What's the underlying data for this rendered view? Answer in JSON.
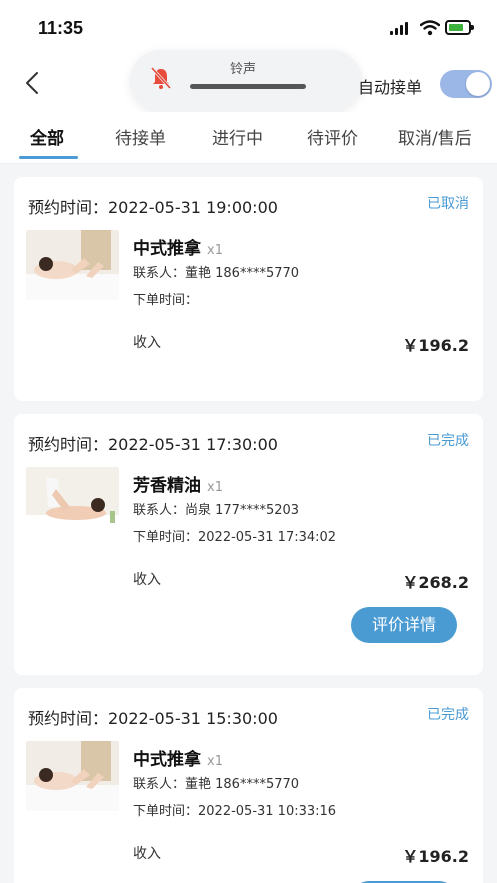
{
  "status_bar": {
    "time": "11:35"
  },
  "header": {
    "ring_label": "铃声",
    "auto_accept_label": "自动接单",
    "auto_accept_on": true
  },
  "tabs": [
    {
      "label": "全部",
      "active": true
    },
    {
      "label": "待接单",
      "active": false
    },
    {
      "label": "进行中",
      "active": false
    },
    {
      "label": "待评价",
      "active": false
    },
    {
      "label": "取消/售后",
      "active": false
    }
  ],
  "orders": [
    {
      "appointment": "预约时间：2022-05-31 19:00:00",
      "status": "已取消",
      "service": "中式推拿",
      "qty": "x1",
      "contact": "联系人：董艳 186****5770",
      "order_time": "下单时间：",
      "income_label": "收入",
      "price": "￥196.2",
      "thumb": "massage-back-icon"
    },
    {
      "appointment": "预约时间：2022-05-31 17:30:00",
      "status": "已完成",
      "service": "芳香精油",
      "qty": "x1",
      "contact": "联系人：尚泉 177****5203",
      "order_time": "下单时间：2022-05-31 17:34:02",
      "income_label": "收入",
      "price": "￥268.2",
      "button": "评价详情",
      "thumb": "aroma-oil-icon"
    },
    {
      "appointment": "预约时间：2022-05-31 15:30:00",
      "status": "已完成",
      "service": "中式推拿",
      "qty": "x1",
      "contact": "联系人：董艳 186****5770",
      "order_time": "下单时间：2022-05-31 10:33:16",
      "income_label": "收入",
      "price": "￥196.2",
      "thumb": "massage-back-icon"
    }
  ],
  "colors": {
    "accent": "#4b9bd3",
    "tab_underline": "#4c9bd6",
    "switch_on": "#9bb7e8"
  }
}
